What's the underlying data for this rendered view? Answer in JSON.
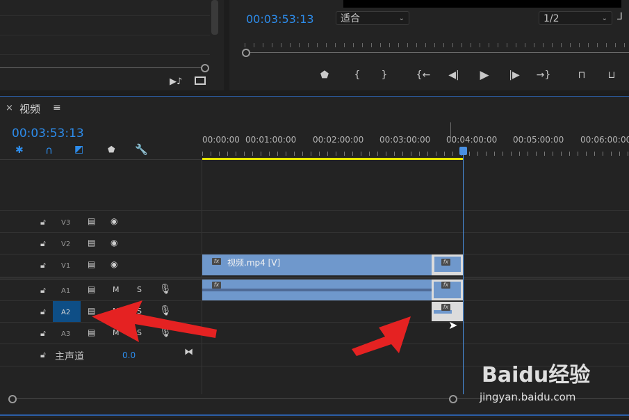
{
  "program_monitor": {
    "timecode": "00:03:53:13",
    "zoom_select": "适合",
    "resolution_select": "1/2",
    "controls": [
      "add-marker",
      "mark-in",
      "mark-out",
      "go-to-in",
      "step-back",
      "play",
      "step-forward",
      "go-to-out",
      "lift",
      "extract"
    ]
  },
  "timeline": {
    "close_glyph": "×",
    "tab_title": "视频",
    "menu_glyph": "≡",
    "timecode": "00:03:53:13",
    "ruler": [
      "00:00:00",
      "00:01:00:00",
      "00:02:00:00",
      "00:03:00:00",
      "00:04:00:00",
      "00:05:00:00",
      "00:06:00:00"
    ],
    "tracks": {
      "video": [
        "V3",
        "V2",
        "V1"
      ],
      "audio": [
        "A1",
        "A2",
        "A3"
      ],
      "mute_label": "M",
      "solo_label": "S"
    },
    "master": {
      "label": "主声道",
      "value": "0.0"
    },
    "clip": {
      "name": "视频.mp4 [V]",
      "fx": "fx"
    }
  },
  "watermark": {
    "brand": "Baidu经验",
    "url": "jingyan.baidu.com"
  },
  "colors": {
    "accent": "#2d8ceb",
    "clip": "#6f98cc",
    "playhead": "#4a90e2",
    "work_area": "#e6e600",
    "arrow": "#e52222"
  }
}
